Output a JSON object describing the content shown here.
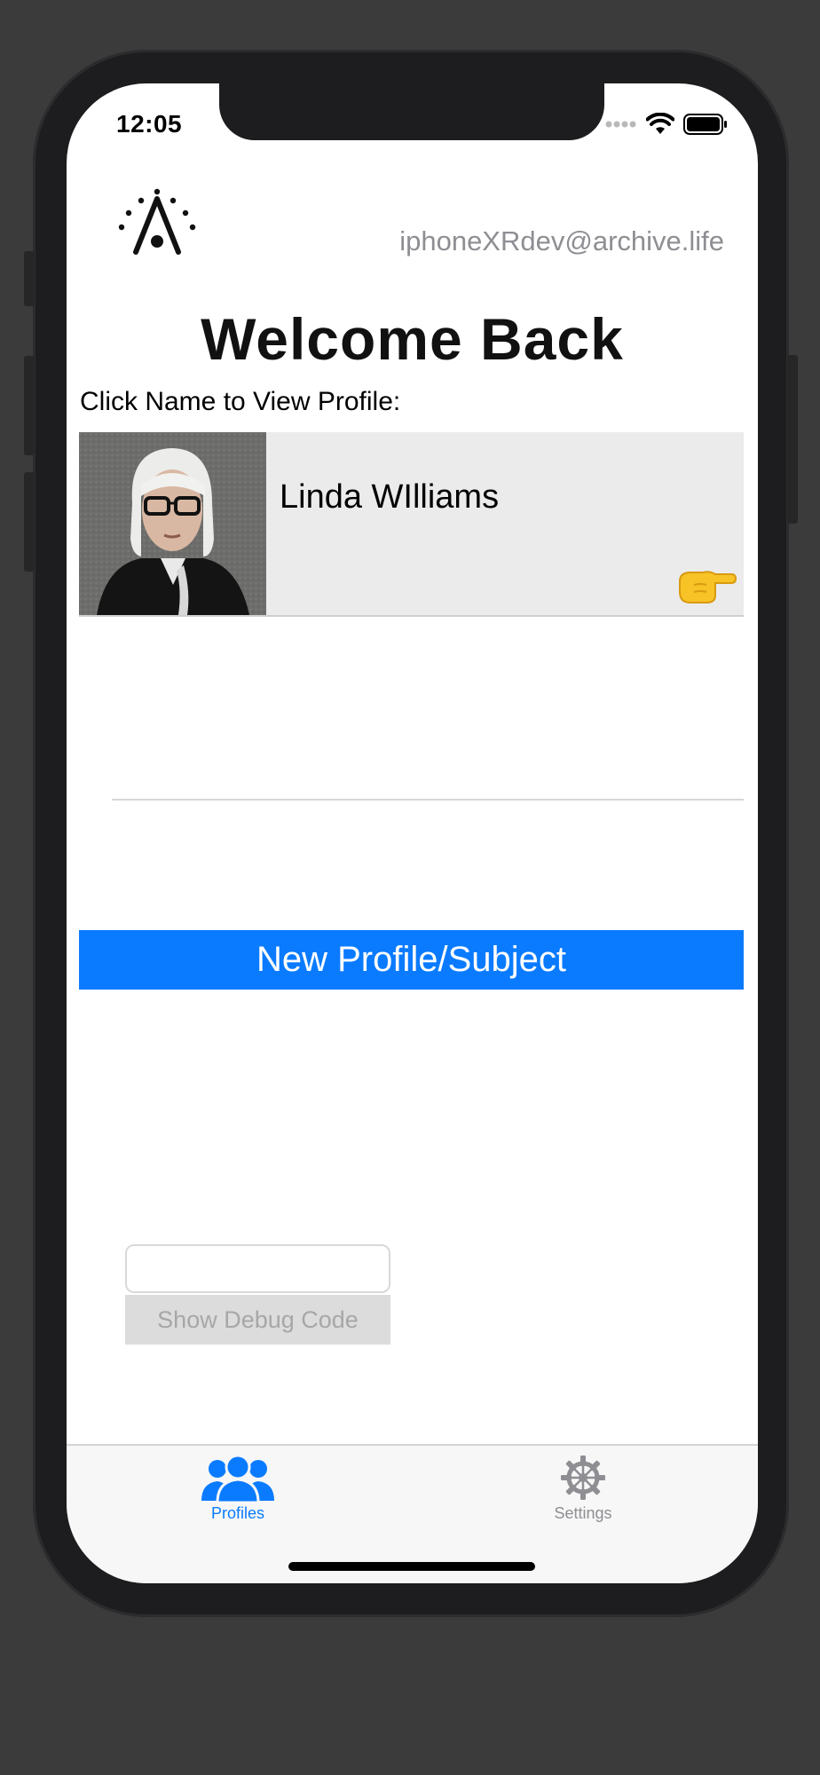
{
  "status_bar": {
    "time": "12:05"
  },
  "header": {
    "account_email": "iphoneXRdev@archive.life",
    "logo_icon": "archive-life-logo"
  },
  "main": {
    "title": "Welcome Back",
    "prompt": "Click Name to View Profile:",
    "profiles": [
      {
        "name": "Linda WIlliams",
        "photo": "profile-photo",
        "action_icon": "pointing-right-hand-icon"
      }
    ],
    "new_profile_label": "New Profile/Subject",
    "debug_input_value": "",
    "debug_button_label": "Show Debug Code"
  },
  "tab_bar": {
    "tabs": [
      {
        "label": "Profiles",
        "icon": "people-icon",
        "selected": true
      },
      {
        "label": "Settings",
        "icon": "gear-icon",
        "selected": false
      }
    ]
  },
  "colors": {
    "accent": "#0a7bff",
    "tab_inactive": "#8e8e93",
    "card_background": "#ebebeb"
  }
}
